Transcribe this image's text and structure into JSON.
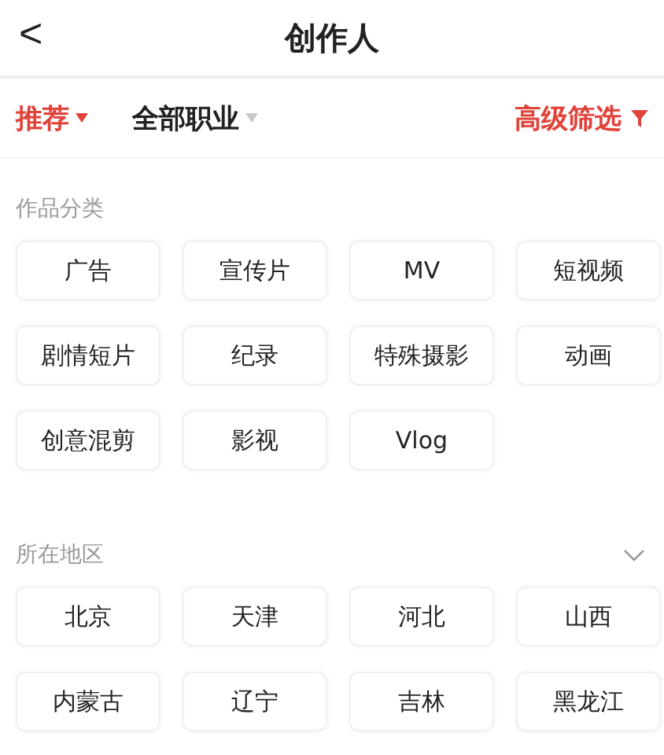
{
  "header": {
    "back": "<",
    "title": "创作人"
  },
  "filters": [
    {
      "label": "推荐",
      "selected": true
    },
    {
      "label": "全部职业",
      "selected": false
    }
  ],
  "advanced_filter": {
    "label": "高级筛选"
  },
  "sections": [
    {
      "title": "作品分类",
      "collapsible": false,
      "options": [
        "广告",
        "宣传片",
        "MV",
        "短视频",
        "剧情短片",
        "纪录",
        "特殊摄影",
        "动画",
        "创意混剪",
        "影视",
        "Vlog"
      ]
    },
    {
      "title": "所在地区",
      "collapsible": true,
      "options": [
        "北京",
        "天津",
        "河北",
        "山西",
        "内蒙古",
        "辽宁",
        "吉林",
        "黑龙江"
      ]
    }
  ]
}
